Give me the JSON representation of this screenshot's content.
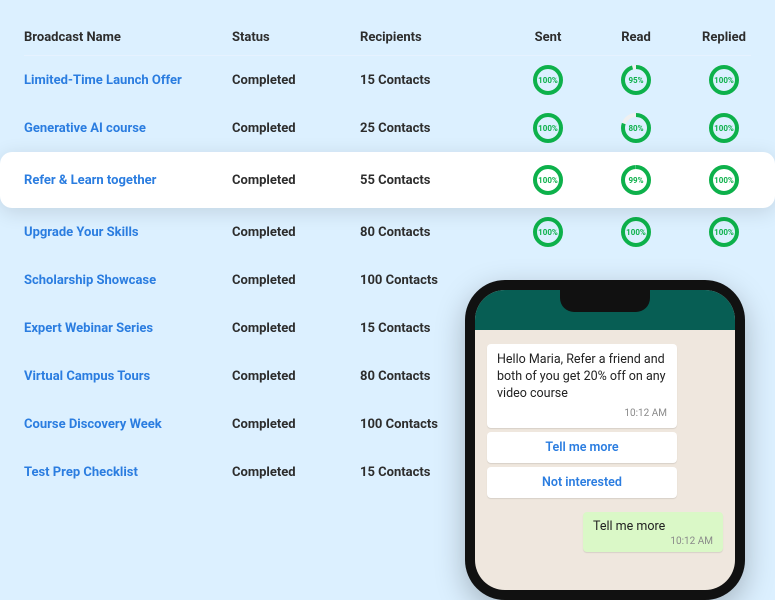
{
  "columns": {
    "name": "Broadcast Name",
    "status": "Status",
    "recipients": "Recipients",
    "sent": "Sent",
    "read": "Read",
    "replied": "Replied"
  },
  "rows": [
    {
      "name": "Limited-Time Launch Offer",
      "status": "Completed",
      "recipients": "15 Contacts",
      "sent": 100,
      "read": 95,
      "replied": 100,
      "highlight": false
    },
    {
      "name": "Generative AI course",
      "status": "Completed",
      "recipients": "25 Contacts",
      "sent": 100,
      "read": 80,
      "replied": 100,
      "highlight": false
    },
    {
      "name": "Refer & Learn together",
      "status": "Completed",
      "recipients": "55 Contacts",
      "sent": 100,
      "read": 99,
      "replied": 100,
      "highlight": true
    },
    {
      "name": "Upgrade Your Skills",
      "status": "Completed",
      "recipients": "80 Contacts",
      "sent": 100,
      "read": 100,
      "replied": 100,
      "highlight": false
    },
    {
      "name": "Scholarship Showcase",
      "status": "Completed",
      "recipients": "100 Contacts",
      "sent": null,
      "read": null,
      "replied": null,
      "highlight": false
    },
    {
      "name": "Expert Webinar Series",
      "status": "Completed",
      "recipients": "15 Contacts",
      "sent": null,
      "read": null,
      "replied": null,
      "highlight": false
    },
    {
      "name": "Virtual Campus Tours",
      "status": "Completed",
      "recipients": "80 Contacts",
      "sent": null,
      "read": null,
      "replied": null,
      "highlight": false
    },
    {
      "name": "Course Discovery Week",
      "status": "Completed",
      "recipients": "100 Contacts",
      "sent": null,
      "read": null,
      "replied": null,
      "highlight": false
    },
    {
      "name": "Test Prep Checklist",
      "status": "Completed",
      "recipients": "15 Contacts",
      "sent": null,
      "read": null,
      "replied": null,
      "highlight": false
    }
  ],
  "chat": {
    "incoming": "Hello Maria, Refer a friend and both of you get 20% off on any video course",
    "time1": "10:12 AM",
    "opt1": "Tell me more",
    "opt2": "Not interested",
    "reply": "Tell me more",
    "time2": "10:12 AM"
  },
  "colors": {
    "ring_green": "#0db14b",
    "link_blue": "#2b7de0",
    "whatsapp_header": "#075e54"
  }
}
